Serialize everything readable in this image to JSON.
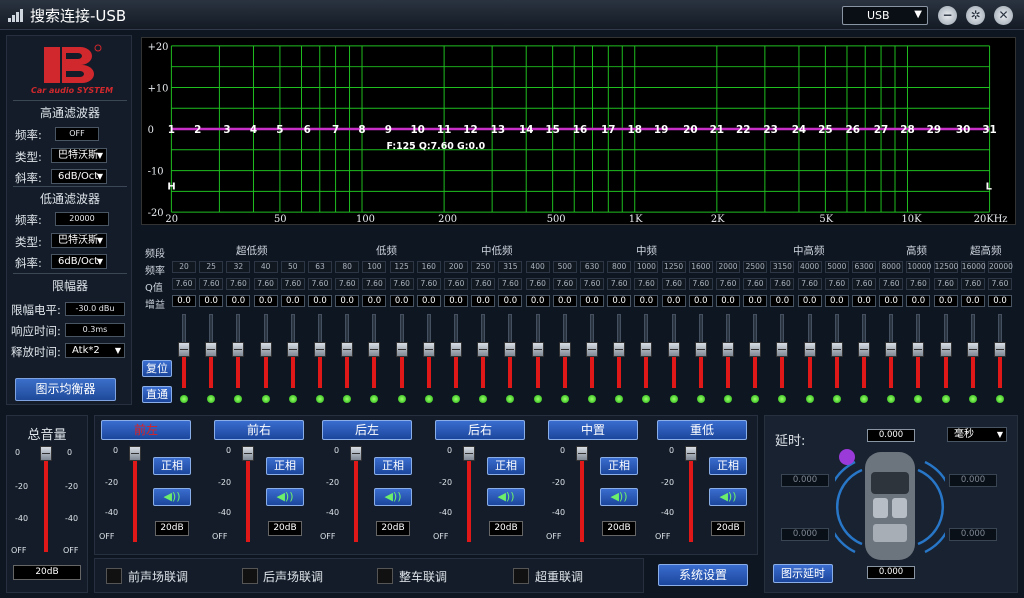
{
  "window": {
    "title": "搜索连接-USB",
    "device": "USB"
  },
  "logo": {
    "text": "Car audio SYSTEM"
  },
  "highpass": {
    "title": "高通滤波器",
    "freq_label": "频率:",
    "freq_value": "OFF",
    "type_label": "类型:",
    "type_value": "巴特沃斯",
    "slope_label": "斜率:",
    "slope_value": "6dB/Oct"
  },
  "lowpass": {
    "title": "低通滤波器",
    "freq_label": "频率:",
    "freq_value": "20000",
    "type_label": "类型:",
    "type_value": "巴特沃斯",
    "slope_label": "斜率:",
    "slope_value": "6dB/Oct"
  },
  "limiter": {
    "title": "限幅器",
    "level_label": "限幅电平:",
    "level_value": "-30.0 dBu",
    "attack_label": "响应时间:",
    "attack_value": "0.3ms",
    "release_label": "释放时间:",
    "release_value": "Atk*2"
  },
  "buttons": {
    "graphic_eq": "图示均衡器",
    "reset": "复位",
    "bypass": "直通",
    "system_settings": "系统设置",
    "graphic_delay": "图示延时"
  },
  "graph": {
    "y_ticks": [
      "+20",
      "+10",
      "0",
      "-10",
      "-20"
    ],
    "x_ticks": [
      "20",
      "50",
      "100",
      "200",
      "500",
      "1K",
      "2K",
      "5K",
      "10K",
      "20KHz"
    ],
    "info": "F:125 Q:7.60 G:0.0",
    "marker_h": "H",
    "marker_l": "L",
    "colors": {
      "grid": "#1fbf1f",
      "curve": "#c830c8"
    }
  },
  "bands": {
    "row_labels": {
      "segment": "频段",
      "freq": "频率",
      "q": "Q值",
      "gain": "增益"
    },
    "categories": [
      "超低频",
      "低频",
      "中低频",
      "中频",
      "中高频",
      "高频",
      "超高频"
    ],
    "numbers": [
      "1",
      "2",
      "3",
      "4",
      "5",
      "6",
      "7",
      "8",
      "9",
      "10",
      "11",
      "12",
      "13",
      "14",
      "15",
      "16",
      "17",
      "18",
      "19",
      "20",
      "21",
      "22",
      "23",
      "24",
      "25",
      "26",
      "27",
      "28",
      "29",
      "30",
      "31"
    ],
    "freqs": [
      "20",
      "25",
      "32",
      "40",
      "50",
      "63",
      "80",
      "100",
      "125",
      "160",
      "200",
      "250",
      "315",
      "400",
      "500",
      "630",
      "800",
      "1000",
      "1250",
      "1600",
      "2000",
      "2500",
      "3150",
      "4000",
      "5000",
      "6300",
      "8000",
      "10000",
      "12500",
      "16000",
      "20000"
    ],
    "q": [
      "7.60",
      "7.60",
      "7.60",
      "7.60",
      "7.60",
      "7.60",
      "7.60",
      "7.60",
      "7.60",
      "7.60",
      "7.60",
      "7.60",
      "7.60",
      "7.60",
      "7.60",
      "7.60",
      "7.60",
      "7.60",
      "7.60",
      "7.60",
      "7.60",
      "7.60",
      "7.60",
      "7.60",
      "7.60",
      "7.60",
      "7.60",
      "7.60",
      "7.60",
      "7.60",
      "7.60"
    ],
    "gains": [
      "0.0",
      "0.0",
      "0.0",
      "0.0",
      "0.0",
      "0.0",
      "0.0",
      "0.0",
      "0.0",
      "0.0",
      "0.0",
      "0.0",
      "0.0",
      "0.0",
      "0.0",
      "0.0",
      "0.0",
      "0.0",
      "0.0",
      "0.0",
      "0.0",
      "0.0",
      "0.0",
      "0.0",
      "0.0",
      "0.0",
      "0.0",
      "0.0",
      "0.0",
      "0.0",
      "0.0"
    ]
  },
  "master": {
    "title": "总音量",
    "scale": [
      "0",
      "-20",
      "-40",
      "OFF"
    ],
    "value": "20dB"
  },
  "channels": [
    {
      "name": "前左",
      "phase": "正相",
      "value": "20dB",
      "active": true
    },
    {
      "name": "前右",
      "phase": "正相",
      "value": "20dB",
      "active": false
    },
    {
      "name": "后左",
      "phase": "正相",
      "value": "20dB",
      "active": false
    },
    {
      "name": "后右",
      "phase": "正相",
      "value": "20dB",
      "active": false
    },
    {
      "name": "中置",
      "phase": "正相",
      "value": "20dB",
      "active": false
    },
    {
      "name": "重低",
      "phase": "正相",
      "value": "20dB",
      "active": false
    }
  ],
  "channel_scale": [
    "0",
    "-20",
    "-40",
    "OFF"
  ],
  "links": [
    "前声场联调",
    "后声场联调",
    "整车联调",
    "超重联调"
  ],
  "delay": {
    "title": "延时:",
    "unit": "毫秒",
    "top": "0.000",
    "fl": "0.000",
    "fr": "0.000",
    "rl": "0.000",
    "rr": "0.000",
    "bottom": "0.000"
  }
}
